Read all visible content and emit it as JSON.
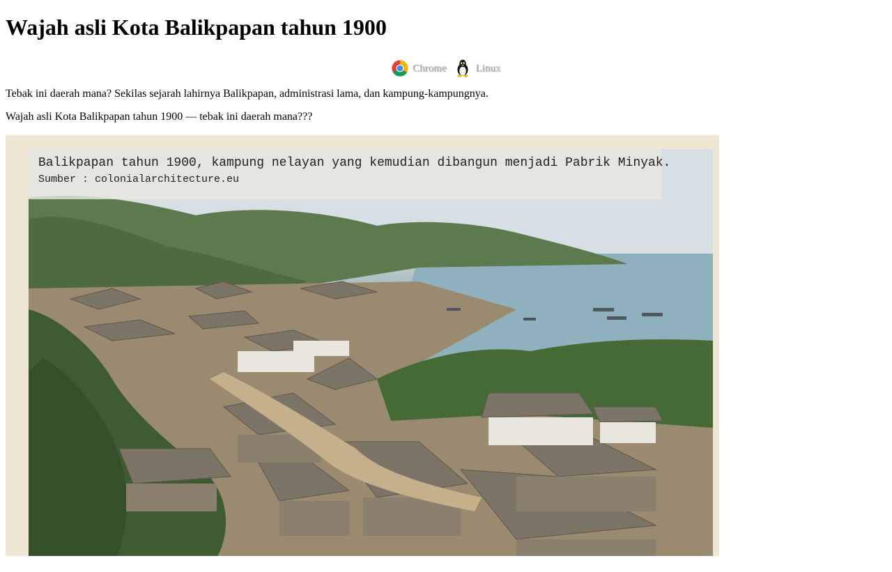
{
  "article": {
    "title": "Wajah asli Kota Balikpapan tahun 1900",
    "environment": [
      {
        "label": "Chrome",
        "icon": "chrome-icon"
      },
      {
        "label": "Linux",
        "icon": "linux-tux-icon"
      }
    ],
    "intro": "Tebak ini daerah mana? Sekilas sejarah lahirnya Balikpapan, administrasi lama, dan kampung-kampungnya.",
    "subheading": "Wajah asli Kota Balikpapan tahun 1900 — tebak ini daerah mana???"
  },
  "photo": {
    "caption_title": "Balikpapan tahun 1900, kampung nelayan yang kemudian dibangun menjadi Pabrik Minyak.",
    "caption_source": "Sumber : colonialarchitecture.eu"
  }
}
